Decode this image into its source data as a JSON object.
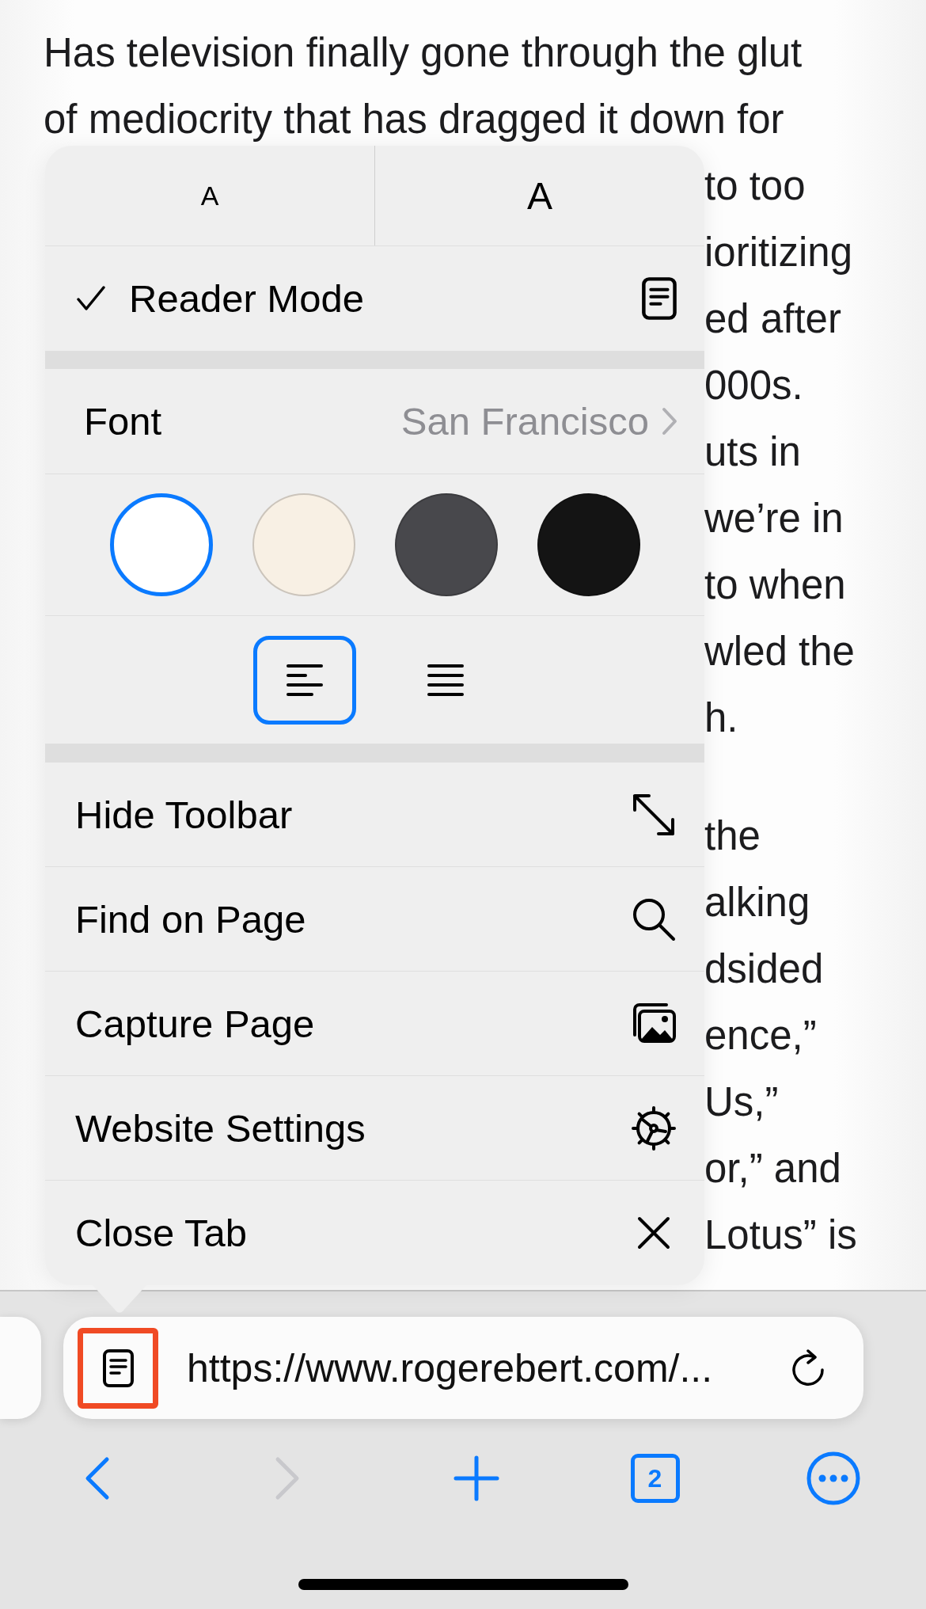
{
  "article": {
    "paragraphs": [
      {
        "lines": [
          {
            "text": "Has television finally gone through the glut",
            "kind": "full"
          },
          {
            "text": "of mediocrity that has dragged it down for",
            "kind": "full"
          },
          {
            "text": "to too",
            "kind": "fragment"
          },
          {
            "text": "ioritizing",
            "kind": "fragment"
          },
          {
            "text": "ed after",
            "kind": "fragment"
          },
          {
            "text": "000s.",
            "kind": "fragment"
          },
          {
            "text": "uts in",
            "kind": "fragment"
          },
          {
            "text": "we’re in",
            "kind": "fragment"
          },
          {
            "text": "to when",
            "kind": "fragment"
          },
          {
            "text": "wled the",
            "kind": "fragment"
          },
          {
            "text": "h.",
            "kind": "fragment"
          }
        ]
      },
      {
        "lines": [
          {
            "text": "the",
            "kind": "fragment"
          },
          {
            "text": "alking",
            "kind": "fragment"
          },
          {
            "text": "dsided",
            "kind": "fragment"
          },
          {
            "text": "ence,”",
            "kind": "fragment"
          },
          {
            "text": "Us,”",
            "kind": "fragment"
          },
          {
            "text": "or,” and",
            "kind": "fragment"
          },
          {
            "text": "Lotus” is",
            "kind": "fragment"
          }
        ]
      }
    ]
  },
  "menu": {
    "text_size": [
      {
        "label": "A",
        "kind": "smaller"
      },
      {
        "label": "A",
        "kind": "larger"
      }
    ],
    "reader_mode": {
      "label": "Reader Mode",
      "checked": true
    },
    "font": {
      "label": "Font",
      "value": "San Francisco"
    },
    "themes": [
      {
        "color": "#ffffff",
        "selected": true
      },
      {
        "color": "#f8f0e4",
        "selected": false
      },
      {
        "color": "#48484c",
        "selected": false
      },
      {
        "color": "#141414",
        "selected": false
      }
    ],
    "alignments": [
      {
        "kind": "left",
        "selected": true
      },
      {
        "kind": "justified",
        "selected": false
      }
    ],
    "actions": [
      {
        "label": "Hide Toolbar",
        "kind": "expand"
      },
      {
        "label": "Find on Page",
        "kind": "search"
      },
      {
        "label": "Capture Page",
        "kind": "photos"
      },
      {
        "label": "Website Settings",
        "kind": "gear"
      },
      {
        "label": "Close Tab",
        "kind": "close"
      }
    ]
  },
  "address_bar": {
    "url": "https://www.rogerebert.com/...",
    "reader_button_highlighted": true
  },
  "toolbar": {
    "buttons": [
      {
        "kind": "back",
        "disabled": false
      },
      {
        "kind": "forward",
        "disabled": true
      },
      {
        "kind": "new-tab",
        "disabled": false
      },
      {
        "kind": "tabs",
        "label": "2",
        "disabled": false
      },
      {
        "kind": "more",
        "disabled": false
      }
    ]
  }
}
